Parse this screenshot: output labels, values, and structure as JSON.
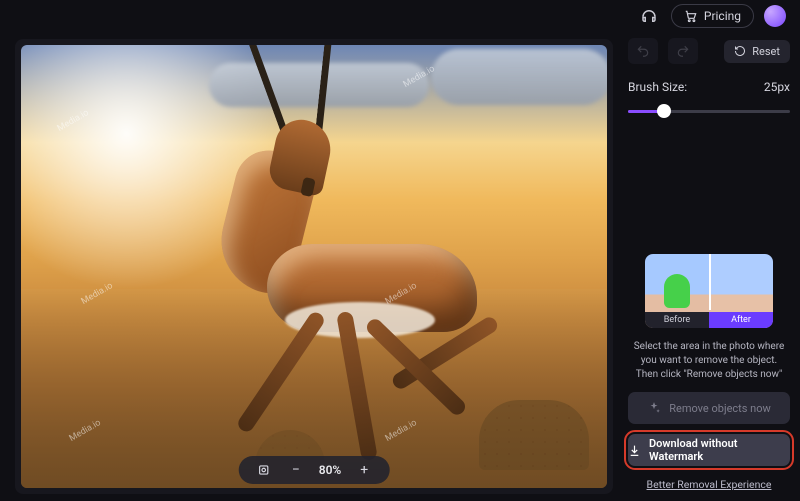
{
  "topbar": {
    "pricing_label": "Pricing"
  },
  "canvas": {
    "watermark_text": "Media.io",
    "zoom_value": "80%"
  },
  "sidebar": {
    "reset_label": "Reset",
    "brush_label": "Brush Size:",
    "brush_value": "25px",
    "brush_percent": 22,
    "preview": {
      "before_label": "Before",
      "after_label": "After"
    },
    "instruction": "Select the area in the photo where you want to remove the object. Then click \"Remove objects now\"",
    "remove_label": "Remove objects now",
    "download_label": "Download without Watermark",
    "better_link": "Better Removal Experience"
  }
}
